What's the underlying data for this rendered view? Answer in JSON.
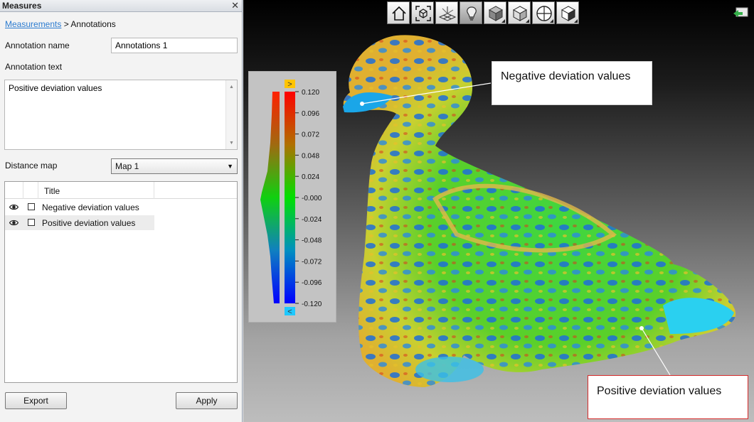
{
  "panel": {
    "title": "Measures",
    "close_glyph": "✕",
    "breadcrumb": {
      "link": "Measurements",
      "separator": " > ",
      "current": "Annotations"
    },
    "annotation_name_label": "Annotation name",
    "annotation_name_value": "Annotations 1",
    "annotation_text_label": "Annotation text",
    "annotation_text_value": "Positive deviation values",
    "distance_map_label": "Distance map",
    "distance_map_value": "Map 1",
    "table": {
      "column_title": "Title",
      "rows": [
        {
          "title": "Negative deviation values",
          "visible": true,
          "checked": false,
          "selected": false
        },
        {
          "title": "Positive deviation values",
          "visible": true,
          "checked": false,
          "selected": true
        }
      ]
    },
    "export_label": "Export",
    "apply_label": "Apply"
  },
  "toolbar": {
    "icons": [
      "home-icon",
      "fit-view-icon",
      "grid-floor-icon",
      "light-bulb-icon",
      "shaded-cube-icon",
      "solid-cube-icon",
      "sphere-icon",
      "box-view-icon"
    ]
  },
  "legend": {
    "ticks": [
      "0.120",
      "0.096",
      "0.072",
      "0.048",
      "0.024",
      "-0.000",
      "-0.024",
      "-0.048",
      "-0.072",
      "-0.096",
      "-0.120"
    ],
    "top_marker": ">",
    "bottom_marker": "<",
    "top_color": "#ffc400",
    "bottom_color": "#1ec8ff"
  },
  "callouts": {
    "negative": "Negative deviation values",
    "positive": "Positive deviation values"
  }
}
